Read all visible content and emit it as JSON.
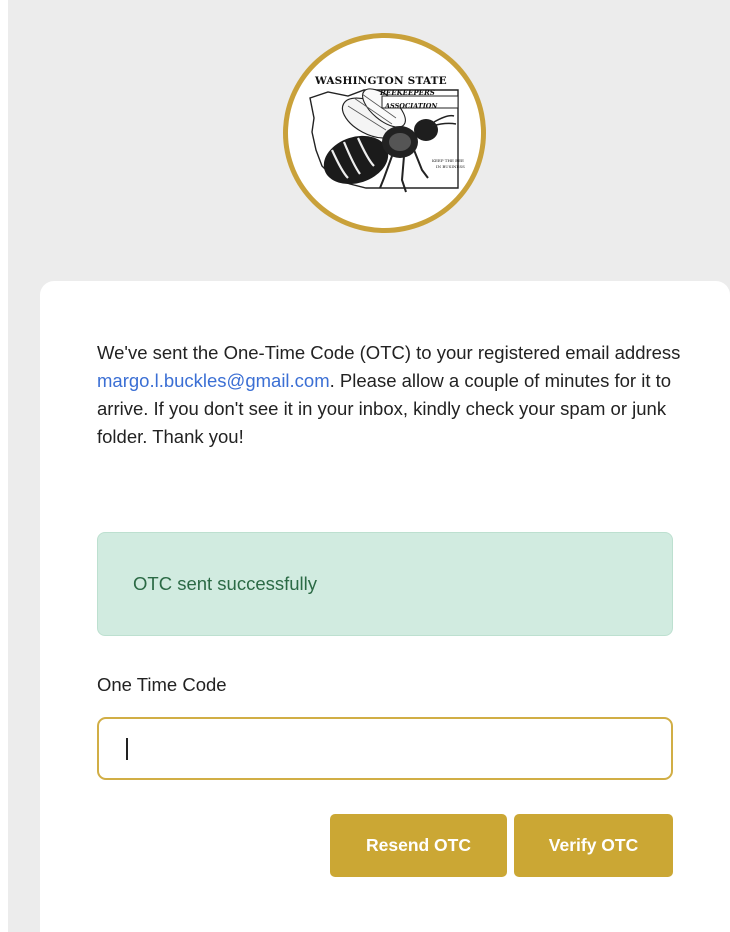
{
  "logo": {
    "line1": "WASHINGTON STATE",
    "line2": "BEEKEEPERS",
    "line3": "ASSOCIATION",
    "tagline": "KEEP THE BEE IN BUSINESS",
    "ring_color": "#c9a13a"
  },
  "message": {
    "before": "We've sent the One-Time Code (OTC) to your registered email address ",
    "email": "margo.l.buckles@gmail.com",
    "after": ". Please allow a couple of minutes for it to arrive. If you don't see it in your inbox, kindly check your spam or junk folder. Thank you!"
  },
  "alert": {
    "text": "OTC sent successfully",
    "background": "#d1ebe0",
    "text_color": "#2b6a45"
  },
  "otc_field": {
    "label": "One Time Code",
    "value": "",
    "placeholder": ""
  },
  "buttons": {
    "resend_label": "Resend OTC",
    "verify_label": "Verify OTC",
    "color": "#cba734"
  },
  "colors": {
    "page_background": "#ececec",
    "link": "#3b6fd4",
    "input_border": "#d1ae45"
  }
}
